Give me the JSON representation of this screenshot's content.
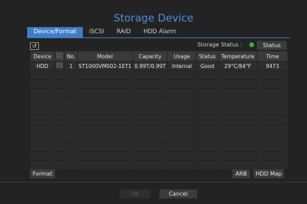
{
  "title": "Storage Device",
  "tabs": [
    {
      "label": "Device/Format"
    },
    {
      "label": "iSCSI"
    },
    {
      "label": "RAID"
    },
    {
      "label": "HDD Alarm"
    }
  ],
  "status_label": "Storage Status :",
  "status_button": "Status",
  "status_color": "#2fb43d",
  "refresh_icon": "refresh-icon",
  "table": {
    "headers": [
      "Device",
      "",
      "No.",
      "Model",
      "Capacity",
      "Usage",
      "Status",
      "Temperature",
      "Time"
    ],
    "rows": [
      {
        "device": "HDD",
        "no": "1",
        "model": "ST1000VM002-1ET1",
        "capacity": "0.99T/0.99T",
        "usage": "Internal",
        "status": "Good",
        "temperature": "29°C/84°F",
        "time": "9473"
      }
    ]
  },
  "buttons": {
    "format": "Format",
    "arb": "ARB",
    "hdd_map": "HDD Map",
    "ok": "OK",
    "cancel": "Cancel"
  }
}
